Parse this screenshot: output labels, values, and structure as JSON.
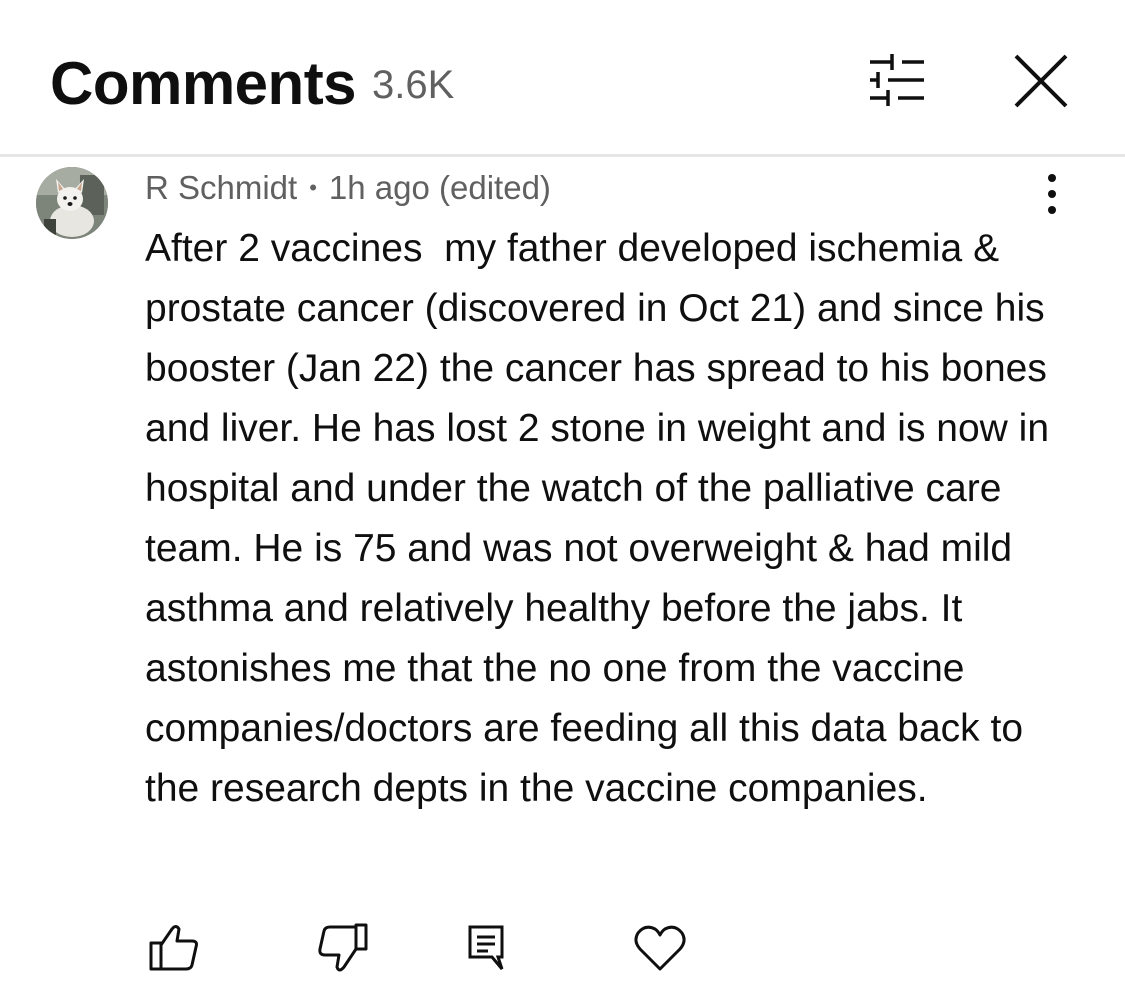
{
  "header": {
    "title": "Comments",
    "count": "3.6K",
    "filter_icon": "filter-sliders-icon",
    "close_icon": "close-icon"
  },
  "comment": {
    "author": "R Schmidt",
    "separator": "•",
    "time": "1h ago (edited)",
    "text": "After 2 vaccines  my father developed ischemia & prostate cancer (discovered in Oct 21) and since his booster (Jan 22) the cancer has spread to his bones and liver. He has lost 2 stone in weight and is now in hospital and under the watch of the palliative care team. He is 75 and was not overweight & had mild asthma and relatively healthy before the jabs. It astonishes me that the no one from the vaccine companies/doctors are feeding all this data back to the research depts in the vaccine companies.",
    "actions": [
      "thumbs-up-icon",
      "thumbs-down-icon",
      "reply-icon",
      "heart-icon"
    ]
  },
  "colors": {
    "text_primary": "#0f0f0f",
    "text_secondary": "#606060",
    "divider": "#e5e5e5"
  }
}
